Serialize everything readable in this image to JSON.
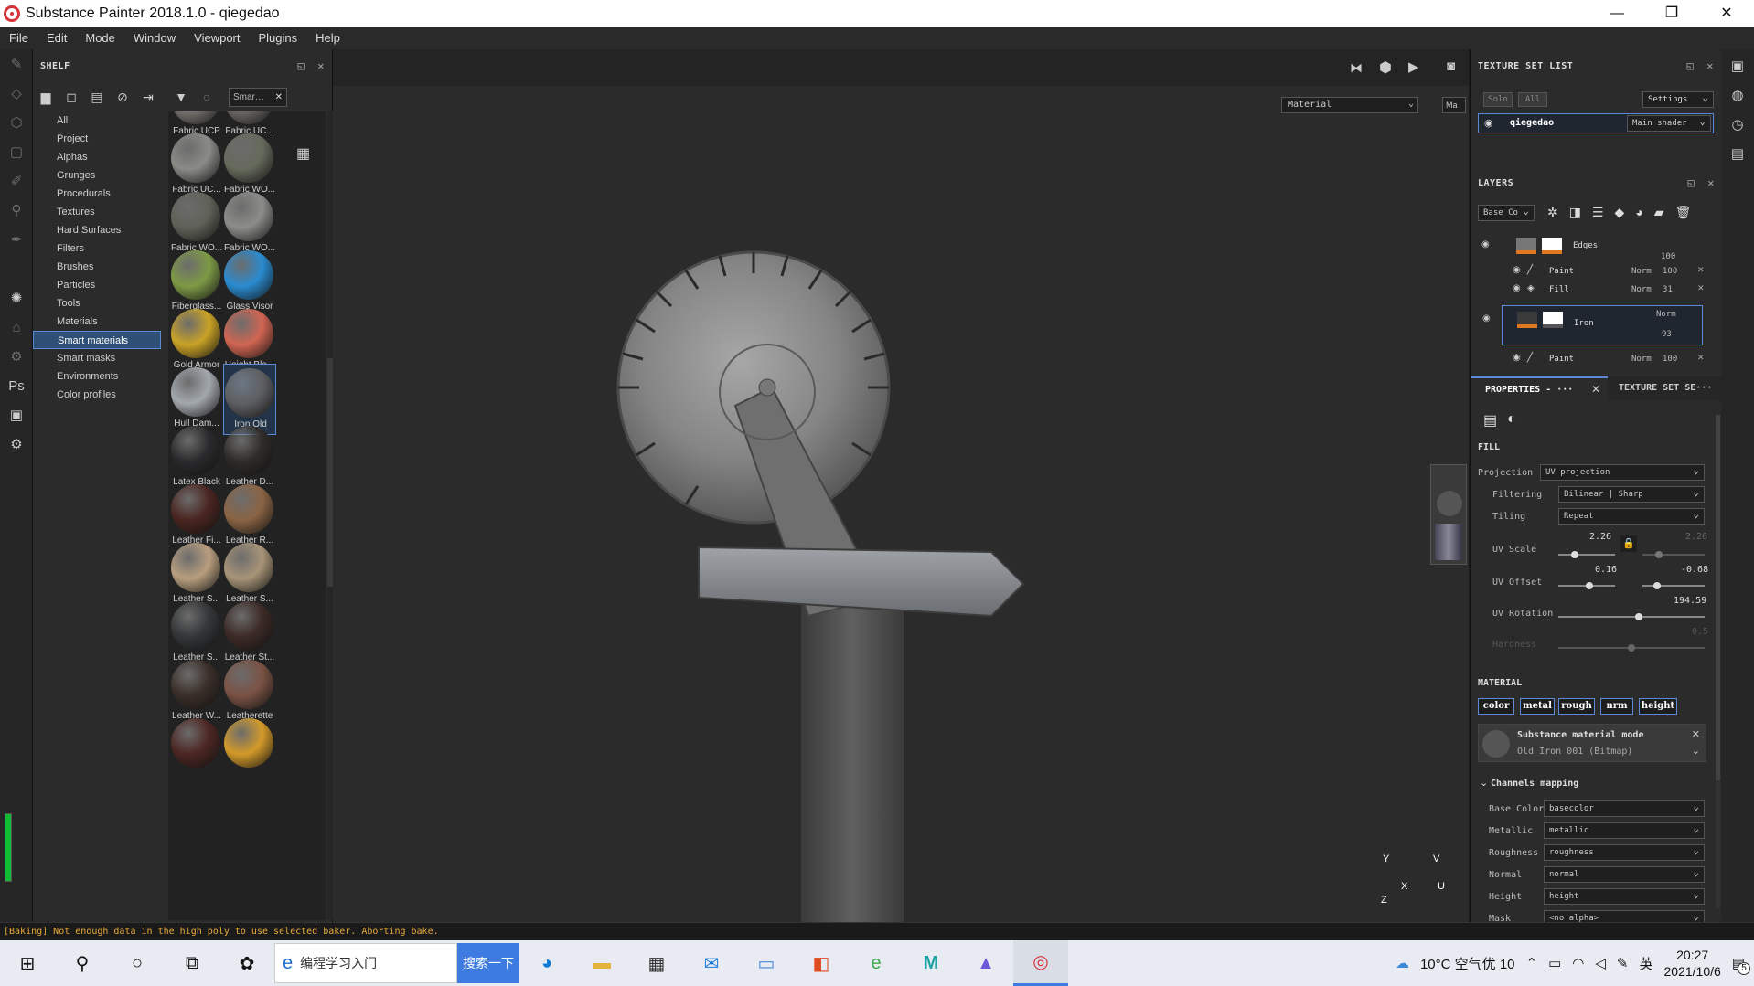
{
  "window": {
    "title": "Substance Painter 2018.1.0 - qiegedao",
    "min": "—",
    "max": "❐",
    "close": "✕"
  },
  "menu": [
    "File",
    "Edit",
    "Mode",
    "Window",
    "Viewport",
    "Plugins",
    "Help"
  ],
  "shelf": {
    "title": "SHELF",
    "filter_text": "Smar…",
    "categories": [
      "All",
      "Project",
      "Alphas",
      "Grunges",
      "Procedurals",
      "Textures",
      "Hard Surfaces",
      "Filters",
      "Brushes",
      "Particles",
      "Tools",
      "Materials",
      "Smart materials",
      "Smart masks",
      "Environments",
      "Color profiles"
    ],
    "selected_category": "Smart materials",
    "items": [
      {
        "label": "Fabric UCP",
        "color": "#7a7570"
      },
      {
        "label": "Fabric UC...",
        "color": "#6e6a66"
      },
      {
        "label": "Fabric UC...",
        "color": "#8a8a86"
      },
      {
        "label": "Fabric WO...",
        "color": "#666a5c"
      },
      {
        "label": "Fabric WO...",
        "color": "#606258"
      },
      {
        "label": "Fabric WO...",
        "color": "#8c8c8a"
      },
      {
        "label": "Fiberglass...",
        "color": "#7d9a45"
      },
      {
        "label": "Glass Visor",
        "color": "#2a8bd0"
      },
      {
        "label": "Gold Armor",
        "color": "#c9a226"
      },
      {
        "label": "Height Ble...",
        "color": "#d06552"
      },
      {
        "label": "Hull Dam...",
        "color": "#a3a8ae"
      },
      {
        "label": "Iron Old",
        "color": "#5d5e60"
      },
      {
        "label": "Latex Black",
        "color": "#2a2a2c"
      },
      {
        "label": "Leather D...",
        "color": "#2e2b29"
      },
      {
        "label": "Leather Fi...",
        "color": "#4a2520"
      },
      {
        "label": "Leather R...",
        "color": "#8a6444"
      },
      {
        "label": "Leather S...",
        "color": "#b89e7e"
      },
      {
        "label": "Leather S...",
        "color": "#a89478"
      },
      {
        "label": "Leather S...",
        "color": "#333537"
      },
      {
        "label": "Leather St...",
        "color": "#3c2a26"
      },
      {
        "label": "Leather W...",
        "color": "#3a2e28"
      },
      {
        "label": "Leatherette",
        "color": "#7a5244"
      },
      {
        "label": "",
        "color": "#4c2622"
      },
      {
        "label": "",
        "color": "#d39a2a"
      }
    ],
    "selected_item": "Iron Old"
  },
  "viewport": {
    "material_dropdown": "Material",
    "second_dropdown": "Ma",
    "axis_x": "X",
    "axis_y": "Y",
    "axis_z": "Z",
    "axis_u": "U",
    "axis_v": "V"
  },
  "texture_set_list": {
    "title": "TEXTURE SET LIST",
    "solo": "Solo",
    "all": "All",
    "settings": "Settings",
    "set_name": "qiegedao",
    "shader": "Main shader"
  },
  "layers": {
    "title": "LAYERS",
    "channel": "Base Co",
    "rows": [
      {
        "name": "Edges",
        "blend": "",
        "opacity": "100",
        "type": "group"
      },
      {
        "name": "Paint",
        "blend": "Norm",
        "opacity": "100",
        "type": "paint"
      },
      {
        "name": "Fill",
        "blend": "Norm",
        "opacity": "31",
        "type": "fill"
      },
      {
        "name": "Iron",
        "blend": "Norm",
        "opacity": "93",
        "type": "group"
      },
      {
        "name": "Paint",
        "blend": "Norm",
        "opacity": "100",
        "type": "paint"
      }
    ]
  },
  "properties": {
    "tab1": "PROPERTIES - ···",
    "tab2": "TEXTURE SET SE···",
    "fill_title": "FILL",
    "projection_label": "Projection",
    "projection": "UV projection",
    "filtering_label": "Filtering",
    "filtering": "Bilinear | Sharp",
    "tiling_label": "Tiling",
    "tiling": "Repeat",
    "uvscale_label": "UV Scale",
    "uvscale": "2.26",
    "uvscale2": "2.26",
    "uvoffset_label": "UV Offset",
    "uvoffset_x": "0.16",
    "uvoffset_y": "-0.68",
    "uvrot_label": "UV Rotation",
    "uvrot": "194.59",
    "hardness_label": "Hardness",
    "hardness": "0.5",
    "material_title": "MATERIAL",
    "chips": [
      "color",
      "metal",
      "rough",
      "nrm",
      "height"
    ],
    "mode_title": "Substance material mode",
    "mode_value": "Old Iron 001 (Bitmap)",
    "channels_title": "Channels mapping",
    "mapping": [
      {
        "label": "Base Color",
        "value": "basecolor"
      },
      {
        "label": "Metallic",
        "value": "metallic"
      },
      {
        "label": "Roughness",
        "value": "roughness"
      },
      {
        "label": "Normal",
        "value": "normal"
      },
      {
        "label": "Height",
        "value": "height"
      },
      {
        "label": "Mask",
        "value": "<no alpha>"
      }
    ]
  },
  "status": "[Baking] Not enough data in the high poly to use selected baker. Aborting bake.",
  "taskbar": {
    "search_text": "编程学习入门",
    "search_button": "搜索一下",
    "weather": "10°C 空气优 10",
    "ime": "英",
    "time": "20:27",
    "date": "2021/10/6",
    "notif": "5"
  },
  "colors": {
    "accent": "#5b8bd6",
    "orange": "#e0781f",
    "status": "#e8a93a"
  }
}
